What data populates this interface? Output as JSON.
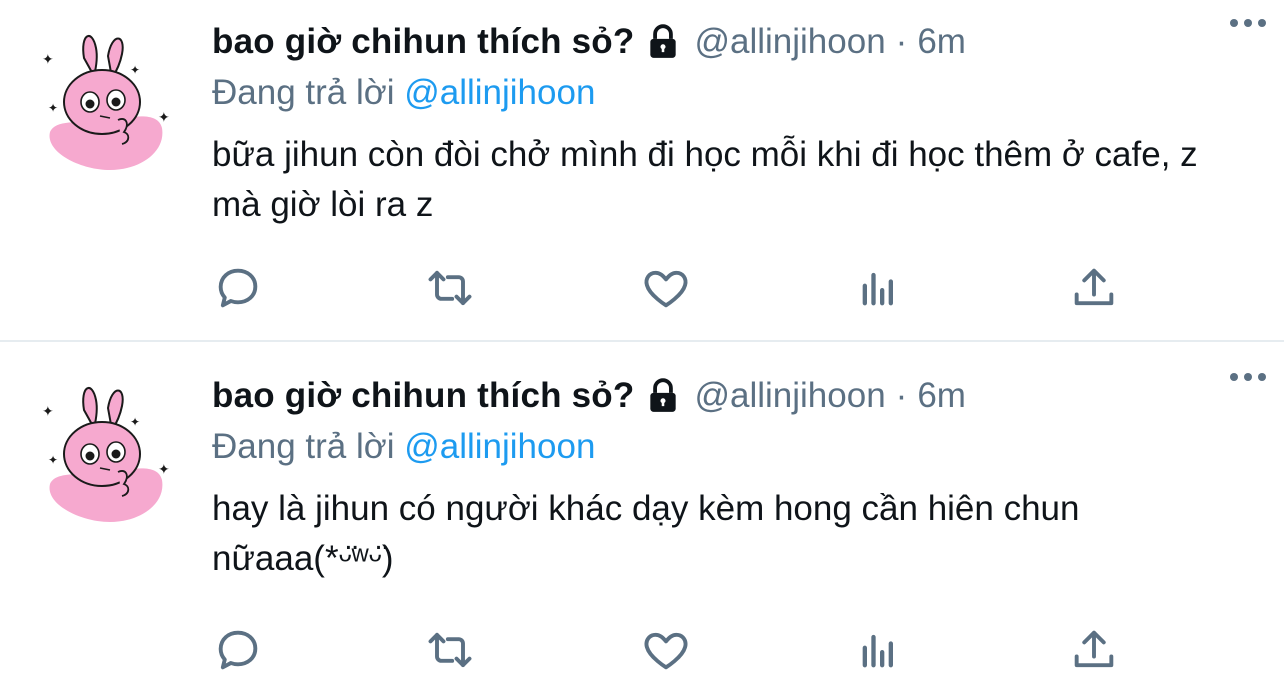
{
  "tweets": [
    {
      "display_name": "bao giờ chihun thích sỏ?",
      "handle": "@allinjihoon",
      "dot": "·",
      "time": "6m",
      "replying_label": "Đang trả lời",
      "replying_to": "@allinjihoon",
      "text": "bữa jihun còn đòi chở mình đi học mỗi khi đi học thêm ở cafe, z mà giờ lòi ra z"
    },
    {
      "display_name": "bao giờ chihun thích sỏ?",
      "handle": "@allinjihoon",
      "dot": "·",
      "time": "6m",
      "replying_label": "Đang trả lời",
      "replying_to": "@allinjihoon",
      "text": "hay là jihun có người khác dạy kèm hong cần hiên chun nữaaa(*ᵕ̈ʷᵕ̈)"
    }
  ],
  "icons": {
    "lock": "lock-icon",
    "more": "more-icon",
    "reply": "reply-icon",
    "retweet": "retweet-icon",
    "like": "heart-icon",
    "stats": "stats-icon",
    "share": "share-icon"
  },
  "colors": {
    "secondary_text": "#5b7083",
    "link": "#1d9bf0",
    "avatar_pink": "#f6a9cf"
  }
}
